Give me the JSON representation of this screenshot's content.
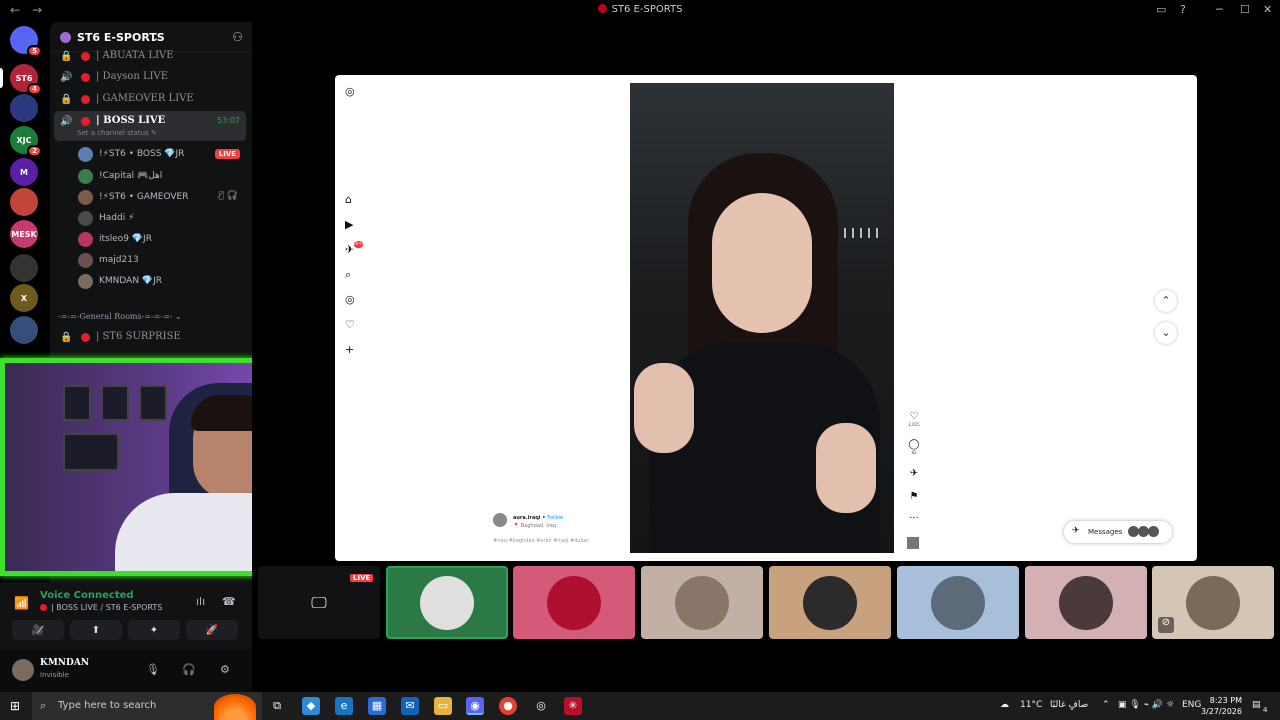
{
  "window": {
    "title": "ST6 E-SPORTS",
    "back": "←",
    "forward": "→",
    "controls": [
      "─",
      "☐",
      "✕"
    ],
    "inbox_icon": "inbox-icon",
    "help_icon": "help-icon"
  },
  "servers": [
    {
      "label": "",
      "badge": "5",
      "color": "#5865f2"
    },
    {
      "label": "ST6",
      "badge": "4",
      "color": "#b3243b"
    },
    {
      "label": "",
      "badge": "",
      "color": "#2b3a80"
    },
    {
      "label": "XJC",
      "badge": "2",
      "color": "#1c7d3b"
    },
    {
      "label": "M",
      "badge": "",
      "color": "#5b1fa4"
    },
    {
      "label": "",
      "badge": "",
      "color": "#c2453a"
    },
    {
      "label": "MESK",
      "badge": "",
      "color": "#c73a6d"
    },
    {
      "label": "",
      "badge": "",
      "color": "#333"
    },
    {
      "label": "X",
      "badge": "",
      "color": "#6d5a1f"
    },
    {
      "label": "",
      "badge": "",
      "color": "#364e7a"
    }
  ],
  "guild": {
    "name": "ST6 E-SPORTS",
    "add_member_icon": "add-member-icon"
  },
  "channels": [
    {
      "label": "| ABUATA LIVE",
      "icon": "🔒",
      "active": false
    },
    {
      "label": "| Dayson LIVE",
      "icon": "🔊",
      "active": false
    },
    {
      "label": "| GAMEOVER LIVE",
      "icon": "🔒",
      "active": false
    },
    {
      "label": "| BOSS LIVE",
      "icon": "🔊",
      "active": true,
      "time": "53:07",
      "status": "Set a channel status ✎"
    }
  ],
  "members": [
    {
      "name": "!⚡ST6 • BOSS 💎JR",
      "live": "LIVE",
      "color": "#5b7fb2"
    },
    {
      "name": "!Capital 🎮اهل",
      "live": "",
      "color": "#3b7d4a"
    },
    {
      "name": "!⚡ST6 • GAMEOVER",
      "live": "",
      "icons": "🎙̸ 🎧̸",
      "color": "#7a5e4a"
    },
    {
      "name": "Haddi ⚡",
      "live": "",
      "color": "#4a4a4a"
    },
    {
      "name": "itsleo9 💎JR",
      "live": "",
      "color": "#b5385a"
    },
    {
      "name": "majd213",
      "live": "",
      "color": "#6a5050"
    },
    {
      "name": "KMNDAN 💎JR",
      "live": "",
      "color": "#7b6a5e"
    }
  ],
  "category": "-=-=-General Rooms-=-=-=- ⌄",
  "surprise_channel": "| ST6 SURPRISE",
  "voice": {
    "status": "Voice Connected",
    "channel": "| BOSS LIVE / ST6 E-SPORTS",
    "actions": [
      "🎥̸",
      "⬆",
      "✦",
      "🚀"
    ]
  },
  "user": {
    "name": "KMNDAN",
    "status": "Invisible"
  },
  "instagram": {
    "nav": [
      "⌂",
      "▶",
      "✈",
      "⌕",
      "◎",
      "♡",
      "+"
    ],
    "nav_badge": "9+",
    "likes": "2,015",
    "comments": "82",
    "caption": {
      "user": "aura.iraqi",
      "follow": "Follow",
      "location": "Baghdad, Iraq",
      "hashtags": "#iraq #baghdad #erbil #iraqi #dubai"
    },
    "messages": "Messages",
    "up": "⌃",
    "down": "⌄"
  },
  "tiles": [
    {
      "color": "#111214",
      "avatar": "#111214",
      "screen": true,
      "live": "LIVE"
    },
    {
      "color": "#2b7a46",
      "avatar": "#e0e0e0",
      "selected": true
    },
    {
      "color": "#d45a7a",
      "avatar": "#b01030"
    },
    {
      "color": "#c2b0a6",
      "avatar": "#8a7668"
    },
    {
      "color": "#c8a27f",
      "avatar": "#2b2b2b"
    },
    {
      "color": "#a8bfd9",
      "avatar": "#5c6b7a"
    },
    {
      "color": "#d2b0b4",
      "avatar": "#4a3a3a"
    },
    {
      "color": "#d5c5b5",
      "avatar": "#7a6a5a",
      "corner": true
    }
  ],
  "taskbar": {
    "search_placeholder": "Type here to search",
    "weather": "11°C",
    "weather_text": "صافٍ غالبًا",
    "lang": "ENG",
    "time": "8:23 PM",
    "date": "3/27/2026",
    "notif": "4"
  }
}
